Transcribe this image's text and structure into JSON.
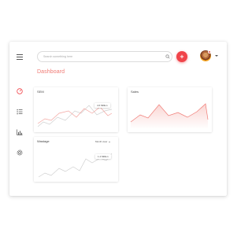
{
  "search": {
    "placeholder": "Search something here"
  },
  "page_title": "Dashboard",
  "header": {
    "add_icon": "plus-icon",
    "avatar": "user-avatar",
    "notification_color": "#e84c4c"
  },
  "accent_color": "#f0444a",
  "sidebar": {
    "items": [
      {
        "icon": "dashboard-dial-icon",
        "active": true
      },
      {
        "icon": "list-icon",
        "active": false
      },
      {
        "icon": "bar-chart-icon",
        "active": false
      },
      {
        "icon": "gear-icon",
        "active": false
      }
    ]
  },
  "cards": {
    "sem": {
      "title": "SEM",
      "tooltip": "4.6 Million"
    },
    "sales": {
      "title": "Sales"
    },
    "wastage": {
      "title": "Wastage",
      "dropdown": "Month view",
      "tooltip": "1.4 Million"
    }
  }
}
